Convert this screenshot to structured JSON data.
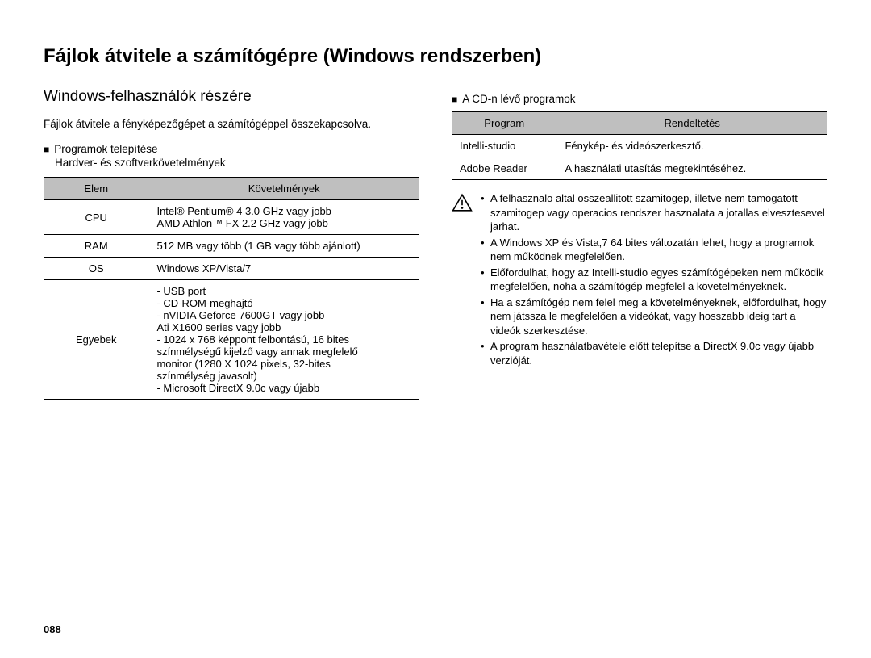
{
  "page_number": "088",
  "title": "Fájlok átvitele a számítógépre (Windows rendszerben)",
  "left": {
    "subtitle": "Windows-felhasználók részére",
    "intro": "Fájlok átvitele a fényképezőgépet a számítógéppel összekapcsolva.",
    "install_heading": "Programok telepítése",
    "install_note": "Hardver- és szoftverkövetelmények",
    "req_table": {
      "headers": [
        "Elem",
        "Követelmények"
      ],
      "rows": [
        {
          "label": "CPU",
          "value": "Intel® Pentium® 4 3.0 GHz vagy jobb\nAMD Athlon™ FX 2.2 GHz vagy jobb"
        },
        {
          "label": "RAM",
          "value": "512 MB vagy több (1 GB vagy több ajánlott)"
        },
        {
          "label": "OS",
          "value": "Windows XP/Vista/7"
        },
        {
          "label": "Egyebek",
          "value": "- USB port\n- CD-ROM-meghajtó\n- nVIDIA Geforce 7600GT vagy jobb\n  Ati X1600 series vagy jobb\n- 1024 x 768 képpont felbontású, 16 bites\n  színmélységű kijelző vagy annak megfelelő\n  monitor (1280 X 1024 pixels, 32-bites\n  színmélység javasolt)\n- Microsoft DirectX 9.0c vagy újabb"
        }
      ]
    }
  },
  "right": {
    "cd_heading": "A CD-n lévő programok",
    "cd_table": {
      "headers": [
        "Program",
        "Rendeltetés"
      ],
      "rows": [
        {
          "label": "Intelli-studio",
          "value": "Fénykép- és videószerkesztő."
        },
        {
          "label": "Adobe Reader",
          "value": "A használati utasítás megtekintéséhez."
        }
      ]
    },
    "notes": [
      "A felhasznalo altal osszeallitott szamitogep, illetve nem tamogatott szamitogep vagy operacios rendszer hasznalata a jotallas elvesztesevel jarhat.",
      "A Windows XP és Vista,7 64 bites változatán lehet, hogy a programok nem működnek megfelelően.",
      "Előfordulhat, hogy az Intelli-studio egyes számítógépeken nem működik megfelelően, noha a számítógép megfelel a követelményeknek.",
      "Ha a számítógép nem felel meg a követelményeknek, előfordulhat, hogy nem játssza le megfelelően a videókat, vagy hosszabb ideig tart a videók szerkesztése.",
      "A program használatbavétele előtt telepítse a DirectX 9.0c vagy újabb verzióját."
    ]
  }
}
